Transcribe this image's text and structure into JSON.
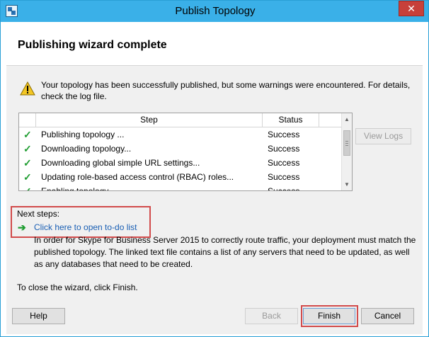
{
  "window": {
    "title": "Publish Topology",
    "close_glyph": "✕"
  },
  "header": {
    "heading": "Publishing wizard complete"
  },
  "message": {
    "icon": "warning-icon",
    "text": "Your topology has been successfully published, but some warnings were encountered. For details, check the log file."
  },
  "steps": {
    "columns": {
      "step": "Step",
      "status": "Status"
    },
    "rows": [
      {
        "check": "✓",
        "step": "Publishing topology ...",
        "status": "Success"
      },
      {
        "check": "✓",
        "step": "Downloading topology...",
        "status": "Success"
      },
      {
        "check": "✓",
        "step": "Downloading global simple URL settings...",
        "status": "Success"
      },
      {
        "check": "✓",
        "step": "Updating role-based access control (RBAC) roles...",
        "status": "Success"
      },
      {
        "check": "✓",
        "step": "Enabling topology...",
        "status": "Success"
      }
    ]
  },
  "buttons": {
    "view_logs": "View Logs",
    "help": "Help",
    "back": "Back",
    "finish": "Finish",
    "cancel": "Cancel"
  },
  "next_steps": {
    "label": "Next steps:",
    "arrow": "➔",
    "link": "Click here to open to-do list",
    "description": "In order for Skype for Business Server 2015 to correctly route traffic, your deployment must match the published topology. The linked text file contains a list of any servers that need to be updated, as well as any databases that need to be created."
  },
  "footer": {
    "close_hint": "To close the wizard, click Finish."
  },
  "colors": {
    "titlebar": "#3ab0e8",
    "close": "#c7403a",
    "link": "#1a5fb4",
    "check": "#1f9d31",
    "highlight": "#d24b4b"
  }
}
